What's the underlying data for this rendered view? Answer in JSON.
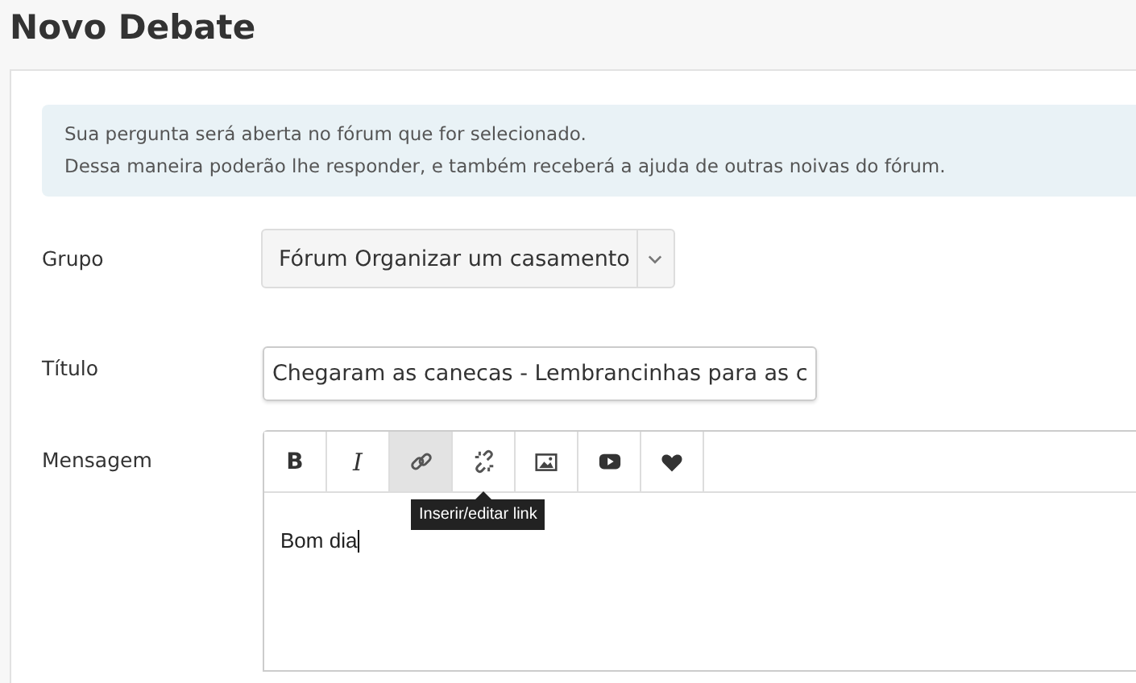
{
  "page_title": "Novo Debate",
  "notice": [
    "Sua pergunta será aberta no fórum que for selecionado.",
    "Dessa maneira poderão lhe responder, e também receberá a ajuda de outras noivas do fórum."
  ],
  "fields": [
    {
      "kind": "select",
      "label": "Grupo",
      "value": "Fórum Organizar um casamento"
    },
    {
      "kind": "text",
      "label": "Título",
      "value": "Chegaram as canecas - Lembrancinhas para as c"
    },
    {
      "kind": "editor",
      "label": "Mensagem",
      "value": "Bom dia",
      "toolbar": [
        {
          "kind": "bold",
          "text": "B",
          "active": false
        },
        {
          "kind": "italic",
          "text": "I",
          "active": false
        },
        {
          "kind": "link",
          "active": true,
          "tooltip": "Inserir/editar link"
        },
        {
          "kind": "unlink",
          "active": false
        },
        {
          "kind": "image",
          "active": false
        },
        {
          "kind": "video",
          "active": false
        },
        {
          "kind": "heart",
          "active": false
        }
      ]
    }
  ]
}
